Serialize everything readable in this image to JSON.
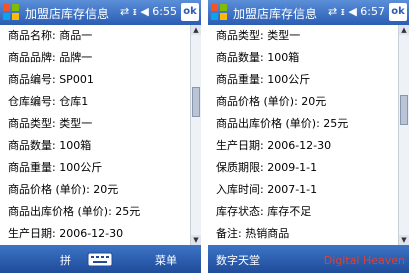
{
  "left": {
    "title": "加盟店库存信息",
    "status": "⇄ ᵻ ◀ 6:55",
    "ok": "ok",
    "rows": [
      "商品名称: 商品一",
      "商品品牌: 品牌一",
      "商品编号: SP001",
      "仓库编号: 仓库1",
      "商品类型: 类型一",
      "商品数量: 100箱",
      "商品重量: 100公斤",
      "商品价格 (单价): 20元",
      "商品出库价格 (单价): 25元",
      "生产日期: 2006-12-30"
    ],
    "menu_left": "拼",
    "menu_right": "菜单"
  },
  "right": {
    "title": "加盟店库存信息",
    "status": "⇄ ᵻ ◀ 6:57",
    "ok": "ok",
    "rows": [
      "商品类型: 类型一",
      "商品数量: 100箱",
      "商品重量: 100公斤",
      "商品价格 (单价): 20元",
      "商品出库价格 (单价): 25元",
      "生产日期: 2006-12-30",
      "保质期限: 2009-1-1",
      "入库时间: 2007-1-1",
      "库存状态: 库存不足",
      "备注: 热销商品"
    ],
    "menu_left": "数字天堂",
    "watermark_prefix": "Digital Heaven"
  }
}
